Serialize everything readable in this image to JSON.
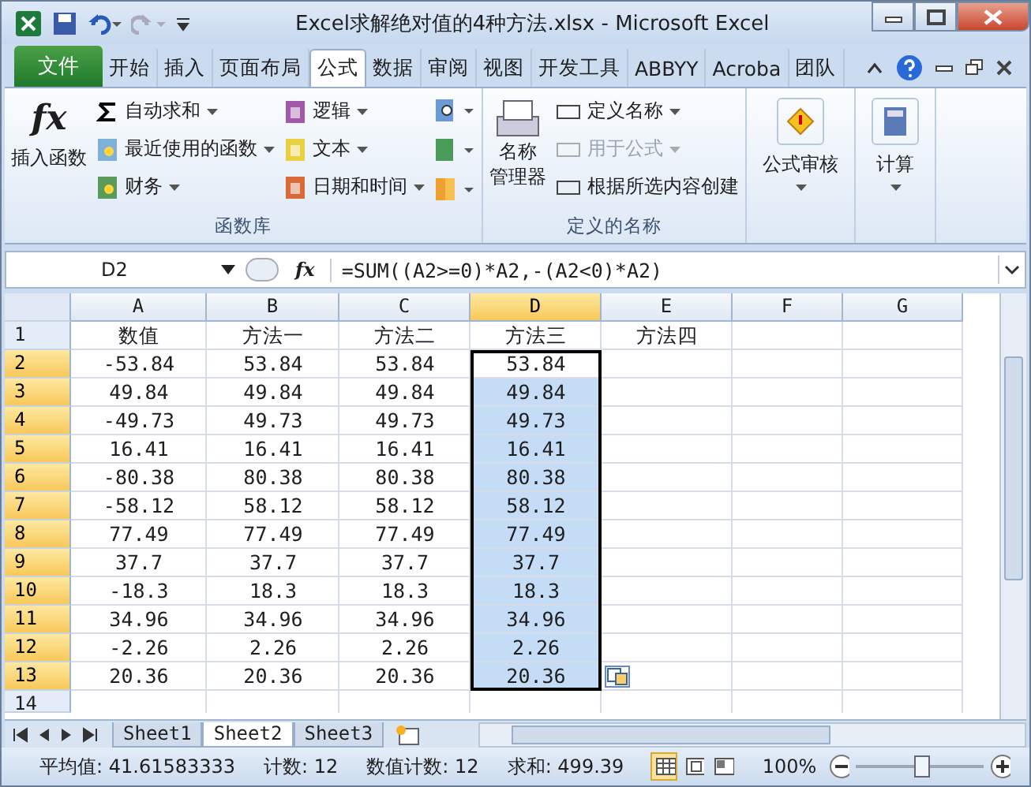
{
  "window": {
    "title": "Excel求解绝对值的4种方法.xlsx  -  Microsoft Excel"
  },
  "file_tab": "文件",
  "tabs": [
    {
      "label": "开始",
      "selected": false
    },
    {
      "label": "插入",
      "selected": false
    },
    {
      "label": "页面布局",
      "selected": false
    },
    {
      "label": "公式",
      "selected": true
    },
    {
      "label": "数据",
      "selected": false
    },
    {
      "label": "审阅",
      "selected": false
    },
    {
      "label": "视图",
      "selected": false
    },
    {
      "label": "开发工具",
      "selected": false
    },
    {
      "label": "ABBYY",
      "selected": false
    },
    {
      "label": "Acroba",
      "selected": false
    },
    {
      "label": "团队",
      "selected": false
    }
  ],
  "ribbon": {
    "function_library": {
      "insert_function_symbol": "fx",
      "insert_function": "插入函数",
      "col1": [
        "自动求和",
        "最近使用的函数",
        "财务"
      ],
      "col2": [
        "逻辑",
        "文本",
        "日期和时间"
      ],
      "group_label": "函数库"
    },
    "defined_names": {
      "name_manager": [
        "名称",
        "管理器"
      ],
      "items": [
        {
          "label": "定义名称",
          "disabled": false,
          "dropdown": true
        },
        {
          "label": "用于公式",
          "disabled": true,
          "dropdown": true
        },
        {
          "label": "根据所选内容创建",
          "disabled": false,
          "dropdown": false
        }
      ],
      "group_label": "定义的名称"
    },
    "auditing": "公式审核",
    "calculation": "计算"
  },
  "formula_bar": {
    "name_box": "D2",
    "fx_symbol": "fx",
    "formula": "=SUM((A2>=0)*A2,-(A2<0)*A2)"
  },
  "columns": [
    {
      "label": "A",
      "selected": false
    },
    {
      "label": "B",
      "selected": false
    },
    {
      "label": "C",
      "selected": false
    },
    {
      "label": "D",
      "selected": true
    },
    {
      "label": "E",
      "selected": false
    },
    {
      "label": "F",
      "selected": false
    },
    {
      "label": "G",
      "selected": false
    }
  ],
  "rows": [
    {
      "number": "1",
      "selected": false,
      "cells": [
        "数值",
        "方法一",
        "方法二",
        "方法三",
        "方法四"
      ]
    },
    {
      "number": "2",
      "selected": true,
      "cells": [
        "-53.84",
        "53.84",
        "53.84",
        "53.84"
      ]
    },
    {
      "number": "3",
      "selected": true,
      "cells": [
        "49.84",
        "49.84",
        "49.84",
        "49.84"
      ]
    },
    {
      "number": "4",
      "selected": true,
      "cells": [
        "-49.73",
        "49.73",
        "49.73",
        "49.73"
      ]
    },
    {
      "number": "5",
      "selected": true,
      "cells": [
        "16.41",
        "16.41",
        "16.41",
        "16.41"
      ]
    },
    {
      "number": "6",
      "selected": true,
      "cells": [
        "-80.38",
        "80.38",
        "80.38",
        "80.38"
      ]
    },
    {
      "number": "7",
      "selected": true,
      "cells": [
        "-58.12",
        "58.12",
        "58.12",
        "58.12"
      ]
    },
    {
      "number": "8",
      "selected": true,
      "cells": [
        "77.49",
        "77.49",
        "77.49",
        "77.49"
      ]
    },
    {
      "number": "9",
      "selected": true,
      "cells": [
        "37.7",
        "37.7",
        "37.7",
        "37.7"
      ]
    },
    {
      "number": "10",
      "selected": true,
      "cells": [
        "-18.3",
        "18.3",
        "18.3",
        "18.3"
      ]
    },
    {
      "number": "11",
      "selected": true,
      "cells": [
        "34.96",
        "34.96",
        "34.96",
        "34.96"
      ]
    },
    {
      "number": "12",
      "selected": true,
      "cells": [
        "-2.26",
        "2.26",
        "2.26",
        "2.26"
      ]
    },
    {
      "number": "13",
      "selected": true,
      "cells": [
        "20.36",
        "20.36",
        "20.36",
        "20.36"
      ]
    },
    {
      "number": "14",
      "selected": false,
      "cells": []
    }
  ],
  "sheets": [
    {
      "label": "Sheet1",
      "selected": false
    },
    {
      "label": "Sheet2",
      "selected": true
    },
    {
      "label": "Sheet3",
      "selected": false
    }
  ],
  "status_bar": {
    "stats": [
      "平均值: 41.61583333",
      "计数: 12",
      "数值计数: 12",
      "求和: 499.39"
    ],
    "zoom": "100%",
    "level": 0.5
  }
}
